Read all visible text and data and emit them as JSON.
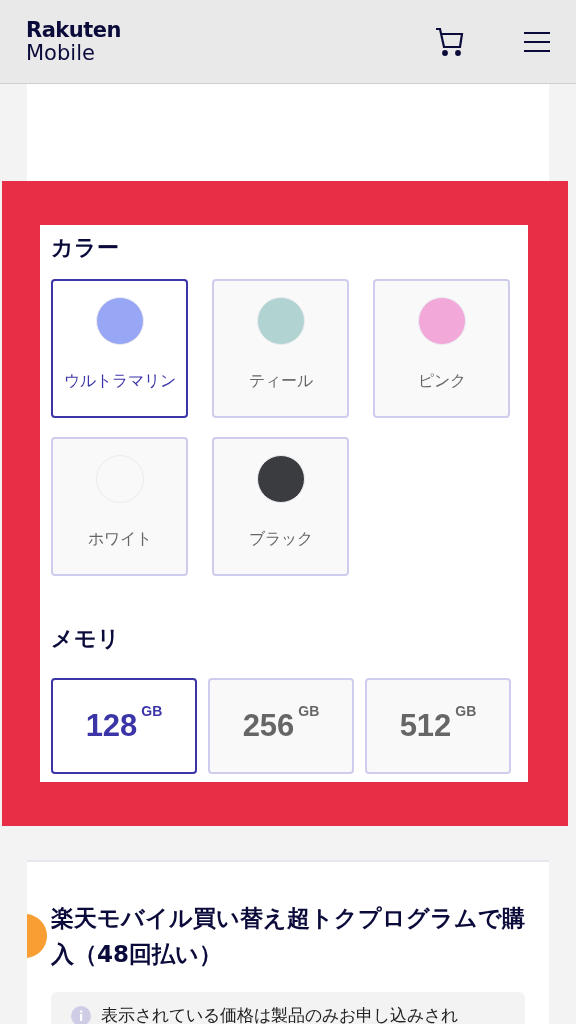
{
  "header": {
    "logo_top": "Rakuten",
    "logo_bottom": "Mobile"
  },
  "color_section": {
    "title": "カラー",
    "options": [
      {
        "label": "ウルトラマリン",
        "color": "#97a6f5",
        "selected": true
      },
      {
        "label": "ティール",
        "color": "#b1d4d2",
        "selected": false
      },
      {
        "label": "ピンク",
        "color": "#f2a8d8",
        "selected": false
      },
      {
        "label": "ホワイト",
        "color": "#f9f9f9",
        "selected": false
      },
      {
        "label": "ブラック",
        "color": "#3a3c40",
        "selected": false
      }
    ]
  },
  "memory_section": {
    "title": "メモリ",
    "options": [
      {
        "value": "128",
        "unit": "GB",
        "selected": true
      },
      {
        "value": "256",
        "unit": "GB",
        "selected": false
      },
      {
        "value": "512",
        "unit": "GB",
        "selected": false
      }
    ]
  },
  "program": {
    "title": "楽天モバイル買い替え超トクプログラムで購入（48回払い）",
    "note": "表示されている価格は製品のみお申し込みされ"
  }
}
